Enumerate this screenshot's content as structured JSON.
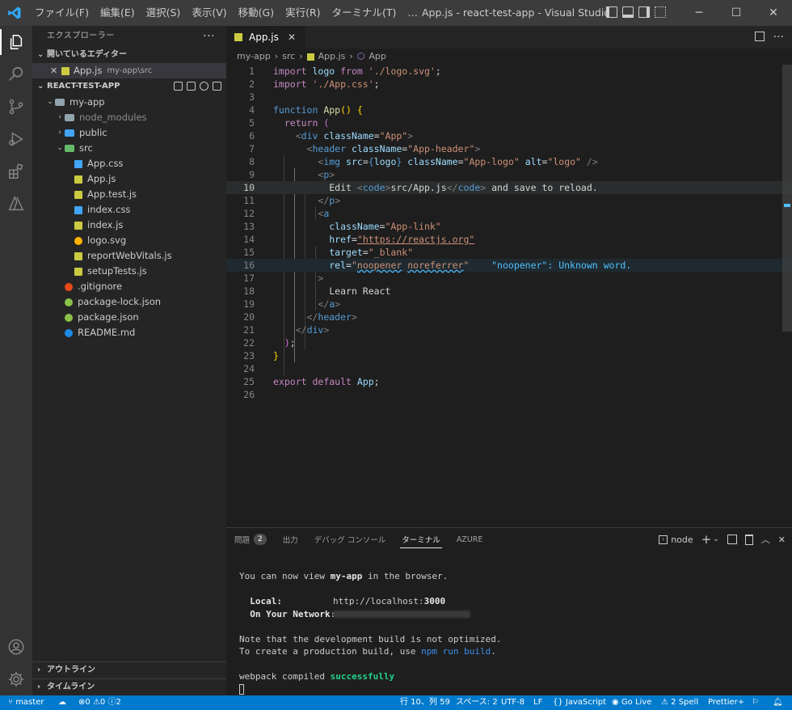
{
  "titlebar": {
    "menu": [
      "ファイル(F)",
      "編集(E)",
      "選択(S)",
      "表示(V)",
      "移動(G)",
      "実行(R)",
      "ターミナル(T)",
      "…"
    ],
    "window_title": "App.js - react-test-app - Visual Studio..."
  },
  "sidebar": {
    "title": "エクスプローラー",
    "open_editors_label": "開いているエディター",
    "open_editor": {
      "name": "App.js",
      "path": "my-app\\src"
    },
    "project_label": "REACT-TEST-APP",
    "tree": [
      {
        "name": "my-app",
        "kind": "folder-open",
        "depth": 1
      },
      {
        "name": "node_modules",
        "kind": "folder",
        "depth": 2,
        "dim": true
      },
      {
        "name": "public",
        "kind": "folder",
        "depth": 2
      },
      {
        "name": "src",
        "kind": "folder-open",
        "depth": 2
      },
      {
        "name": "App.css",
        "kind": "css",
        "depth": 3
      },
      {
        "name": "App.js",
        "kind": "js",
        "depth": 3
      },
      {
        "name": "App.test.js",
        "kind": "js",
        "depth": 3
      },
      {
        "name": "index.css",
        "kind": "css",
        "depth": 3
      },
      {
        "name": "index.js",
        "kind": "js",
        "depth": 3
      },
      {
        "name": "logo.svg",
        "kind": "svg",
        "depth": 3
      },
      {
        "name": "reportWebVitals.js",
        "kind": "js",
        "depth": 3
      },
      {
        "name": "setupTests.js",
        "kind": "js",
        "depth": 3
      },
      {
        "name": ".gitignore",
        "kind": "git",
        "depth": 2
      },
      {
        "name": "package-lock.json",
        "kind": "json",
        "depth": 2
      },
      {
        "name": "package.json",
        "kind": "json",
        "depth": 2
      },
      {
        "name": "README.md",
        "kind": "info",
        "depth": 2
      }
    ],
    "outline_label": "アウトライン",
    "timeline_label": "タイムライン"
  },
  "editor": {
    "tab_label": "App.js",
    "breadcrumb": [
      "my-app",
      "src",
      "App.js",
      "App"
    ],
    "current_line": 10,
    "diagnostic": "\"noopener\": Unknown word."
  },
  "panel": {
    "tabs": [
      "問題",
      "出力",
      "デバッグ コンソール",
      "ターミナル",
      "AZURE"
    ],
    "problems_count": "2",
    "terminal_name": "node",
    "terminal": {
      "l1a": "You can now view ",
      "l1b": "my-app",
      "l1c": " in the browser.",
      "local_label": "  Local:",
      "local_url_a": "http://localhost:",
      "local_url_b": "3000",
      "network_label": "  On Your Network:",
      "l4": "Note that the development build is not optimized.",
      "l5a": "To create a production build, use ",
      "l5b": "npm run build",
      "l5c": ".",
      "l6a": "webpack compiled ",
      "l6b": "successfully"
    }
  },
  "statusbar": {
    "branch": "master",
    "errors": "0",
    "warnings": "0",
    "infos": "2",
    "position": "行 10、列 59",
    "spaces": "スペース: 2",
    "encoding": "UTF-8",
    "eol": "LF",
    "language": "JavaScript",
    "golive": "Go Live",
    "spell": "2 Spell",
    "prettier": "Prettier+"
  },
  "colors": {
    "accent": "#007acc",
    "activitybar": "#333333",
    "sidebar": "#252526",
    "editor": "#1e1e1e"
  }
}
